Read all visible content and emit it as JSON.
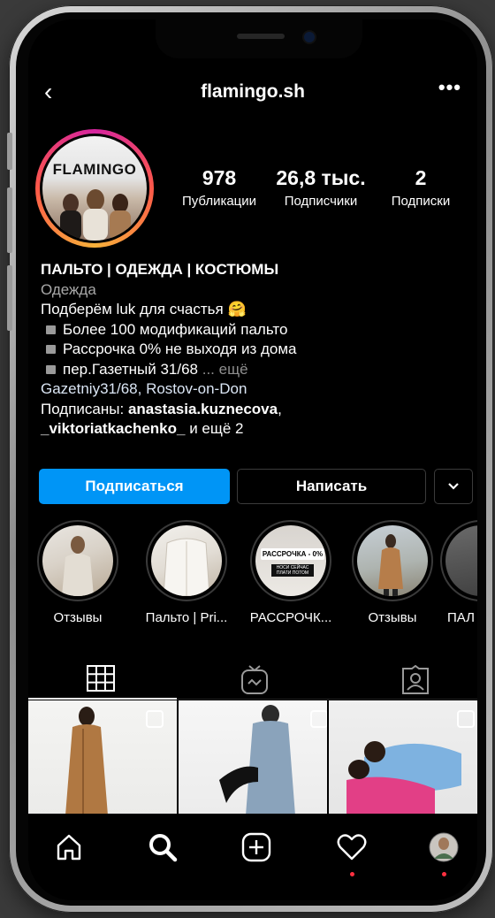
{
  "profile": {
    "username": "flamingo.sh",
    "avatar_logo": "FLAMINGO"
  },
  "stats": [
    {
      "value": "978",
      "label": "Публикации"
    },
    {
      "value": "26,8 тыс.",
      "label": "Подписчики"
    },
    {
      "value": "2",
      "label": "Подписки"
    }
  ],
  "bio": {
    "title": "ПАЛЬТО | ОДЕЖДА | КОСТЮМЫ",
    "category": "Одежда",
    "line1": "Подберём luk для счастья",
    "line1_emoji": "🤗",
    "bullet1": "Более 100 модификаций пальто",
    "bullet2": "Рассрочка 0% не выходя из дома",
    "bullet3": "пер.Газетный 31/68",
    "more": "... ещё",
    "location": "Gazetniy31/68, Rostov-on-Don",
    "followed_prefix": "Подписаны: ",
    "followed_user1": "anastasia.kuznecova",
    "followed_comma": ",",
    "followed_user2": "_viktoriatkachenko_",
    "followed_suffix": " и ещё 2"
  },
  "buttons": {
    "follow": "Подписаться",
    "message": "Написать"
  },
  "highlights": [
    {
      "label": "Отзывы"
    },
    {
      "label": "Пальто | Pri..."
    },
    {
      "label": "РАССРОЧК...",
      "thumb_text1": "РАССРОЧКА - 0%",
      "thumb_text2": "НОСИ СЕЙЧАС\nПЛАТИ ПОТОМ"
    },
    {
      "label": "Отзывы"
    },
    {
      "label": "ПАЛ"
    }
  ],
  "tabs": [
    "grid-icon",
    "igtv-icon",
    "tagged-icon"
  ],
  "nav": [
    "home-icon",
    "search-icon",
    "add-icon",
    "heart-icon",
    "profile-avatar"
  ],
  "colors": {
    "accent": "#0095f6",
    "background": "#000000",
    "notification_dot": "#ff3040"
  }
}
